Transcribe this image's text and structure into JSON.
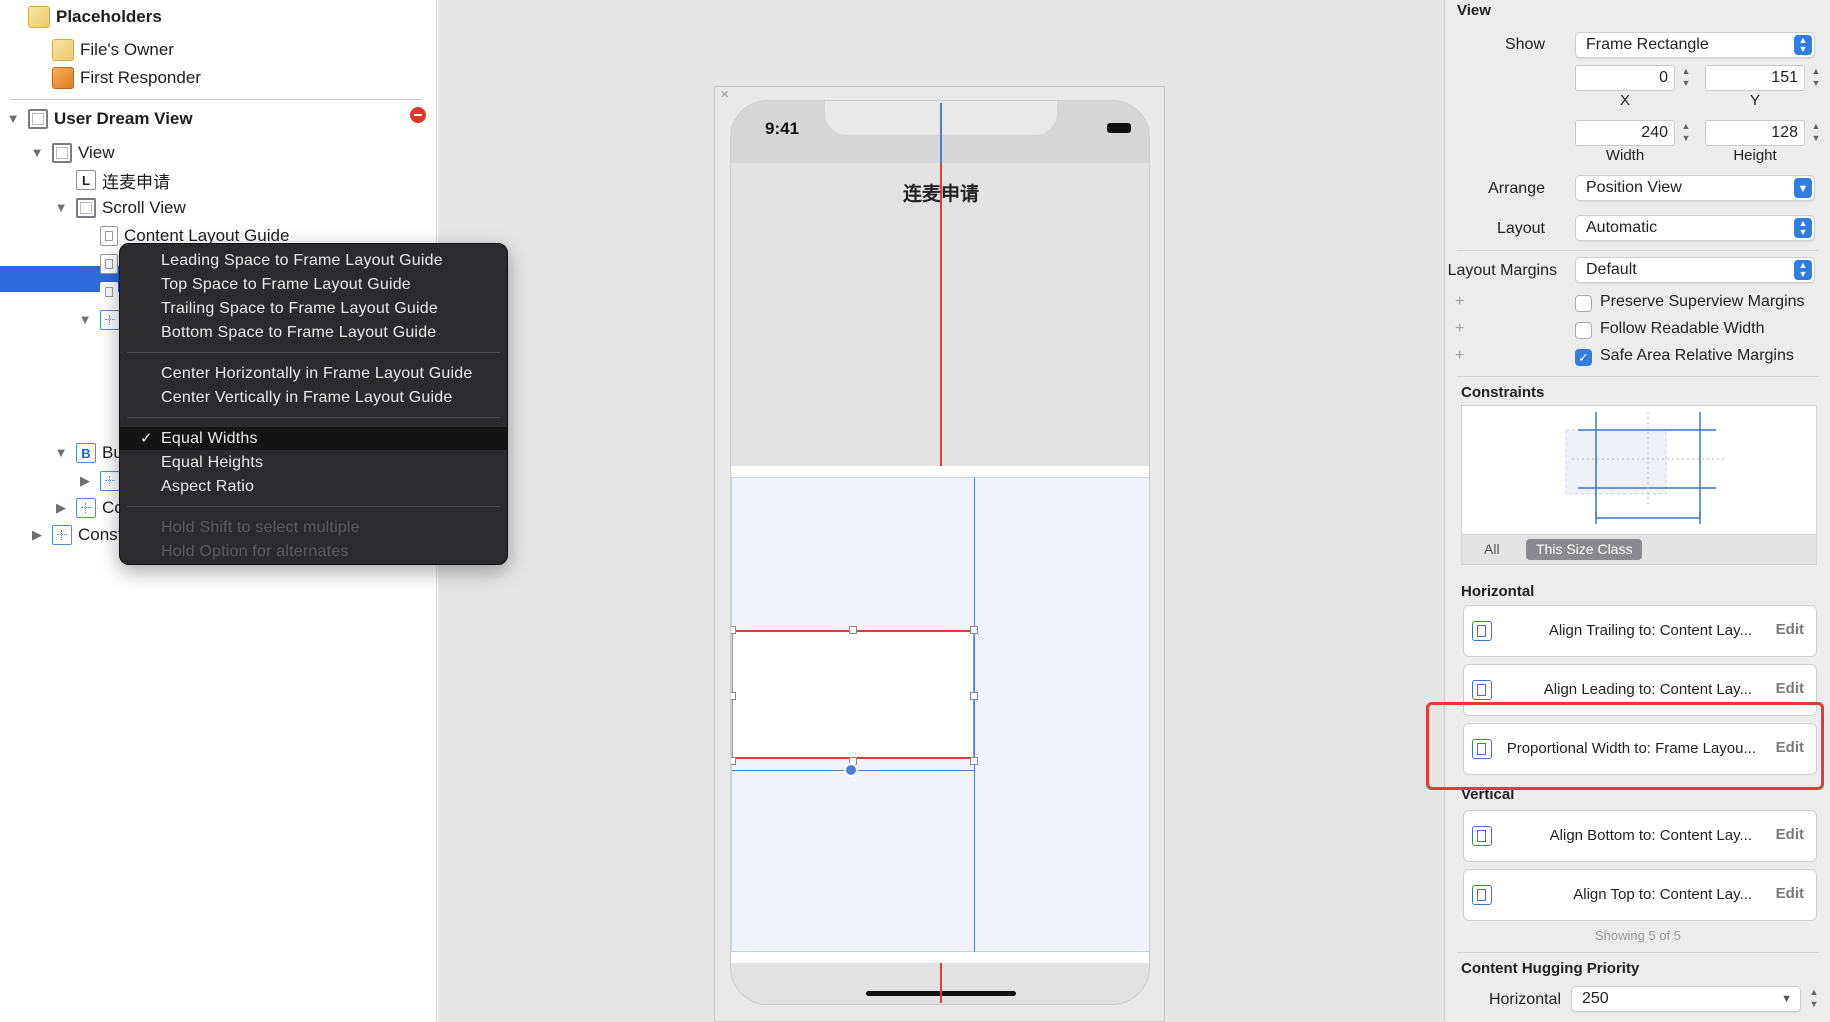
{
  "outline": {
    "placeholders_label": "Placeholders",
    "files_owner": "File's Owner",
    "first_responder": "First Responder",
    "root_view": "User Dream View",
    "view": "View",
    "label_cn": "连麦申请",
    "scroll_view": "Scroll View",
    "content_layout_guide": "Content Layout Guide",
    "bu_partial": "Bu",
    "co_partial": "Co",
    "cons_partial": "Const"
  },
  "context_menu": {
    "items": [
      "Leading Space to Frame Layout Guide",
      "Top Space to Frame Layout Guide",
      "Trailing Space to Frame Layout Guide",
      "Bottom Space to Frame Layout Guide",
      "Center Horizontally in Frame Layout Guide",
      "Center Vertically in Frame Layout Guide",
      "Equal Widths",
      "Equal Heights",
      "Aspect Ratio",
      "Hold Shift to select multiple",
      "Hold Option for alternates"
    ],
    "checked_item": "Equal Widths",
    "check_glyph": "✓"
  },
  "device": {
    "time": "9:41",
    "title_cn": "连麦申请"
  },
  "inspector": {
    "view_header": "View",
    "show_label": "Show",
    "show_value": "Frame Rectangle",
    "x_value": "0",
    "y_value": "151",
    "x_label": "X",
    "y_label": "Y",
    "width_value": "240",
    "height_value": "128",
    "width_label": "Width",
    "height_label": "Height",
    "arrange_label": "Arrange",
    "arrange_value": "Position View",
    "layout_label": "Layout",
    "layout_value": "Automatic",
    "margins_label": "Layout Margins",
    "margins_value": "Default",
    "preserve_label": "Preserve Superview Margins",
    "readable_label": "Follow Readable Width",
    "safe_area_label": "Safe Area Relative Margins",
    "preserve_checked": false,
    "readable_checked": false,
    "safe_area_checked": true,
    "constraints_header": "Constraints",
    "tab_all": "All",
    "tab_size_class": "This Size Class",
    "horizontal_header": "Horizontal",
    "vertical_header": "Vertical",
    "constraints": [
      {
        "text": "Align Trailing to:  Content Lay...",
        "edit": "Edit"
      },
      {
        "text": "Align Leading to:  Content Lay...",
        "edit": "Edit"
      },
      {
        "text": "Proportional Width to: Frame Layou...",
        "edit": "Edit"
      },
      {
        "text": "Align Bottom to:  Content Lay...",
        "edit": "Edit"
      },
      {
        "text": "Align Top to:  Content Lay...",
        "edit": "Edit"
      }
    ],
    "showing": "Showing 5 of 5",
    "hugging_header": "Content Hugging Priority",
    "hugging_h_label": "Horizontal",
    "hugging_h_value": "250"
  },
  "colors": {
    "selection": "#2d6ad8",
    "accent": "#2f7de1",
    "constraint_red": "#e53935",
    "constraint_blue": "#4a7fd6",
    "menu_bg": "#2b2b2d"
  }
}
